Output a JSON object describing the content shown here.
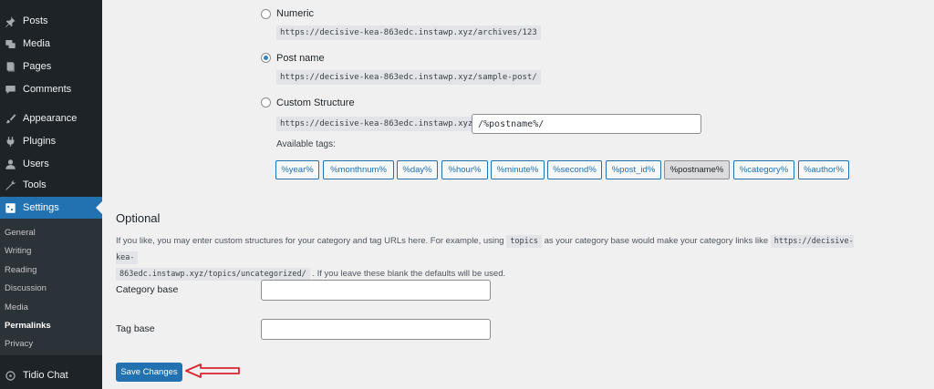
{
  "sidebar": {
    "menu": {
      "posts": "Posts",
      "media": "Media",
      "pages": "Pages",
      "comments": "Comments",
      "appearance": "Appearance",
      "plugins": "Plugins",
      "users": "Users",
      "tools": "Tools",
      "settings": "Settings",
      "tidio": "Tidio Chat"
    },
    "submenu": {
      "general": "General",
      "writing": "Writing",
      "reading": "Reading",
      "discussion": "Discussion",
      "media": "Media",
      "permalinks": "Permalinks",
      "privacy": "Privacy"
    }
  },
  "permalinks": {
    "numeric": {
      "label": "Numeric",
      "example": "https://decisive-kea-863edc.instawp.xyz/archives/123"
    },
    "post_name": {
      "label": "Post name",
      "example": "https://decisive-kea-863edc.instawp.xyz/sample-post/",
      "selected": true
    },
    "custom": {
      "label": "Custom Structure",
      "prefix": "https://decisive-kea-863edc.instawp.xyz",
      "value": "/%postname%/"
    },
    "available_tags_label": "Available tags:",
    "tags": [
      "%year%",
      "%monthnum%",
      "%day%",
      "%hour%",
      "%minute%",
      "%second%",
      "%post_id%",
      "%postname%",
      "%category%",
      "%author%"
    ],
    "active_tag": "%postname%"
  },
  "optional": {
    "heading": "Optional",
    "desc_part1": "If you like, you may enter custom structures for your category and tag URLs here. For example, using",
    "desc_code1": "topics",
    "desc_part2": "as your category base would make your category links like",
    "desc_code2a": "https://decisive-kea-",
    "desc_code2b": "863edc.instawp.xyz/topics/uncategorized/",
    "desc_part3": ". If you leave these blank the defaults will be used.",
    "category_base_label": "Category base",
    "category_base_value": "",
    "tag_base_label": "Tag base",
    "tag_base_value": ""
  },
  "save_button": "Save Changes",
  "colors": {
    "accent": "#2271b1",
    "sidebar": "#1d2327",
    "annotation_arrow": "#d9232d"
  }
}
